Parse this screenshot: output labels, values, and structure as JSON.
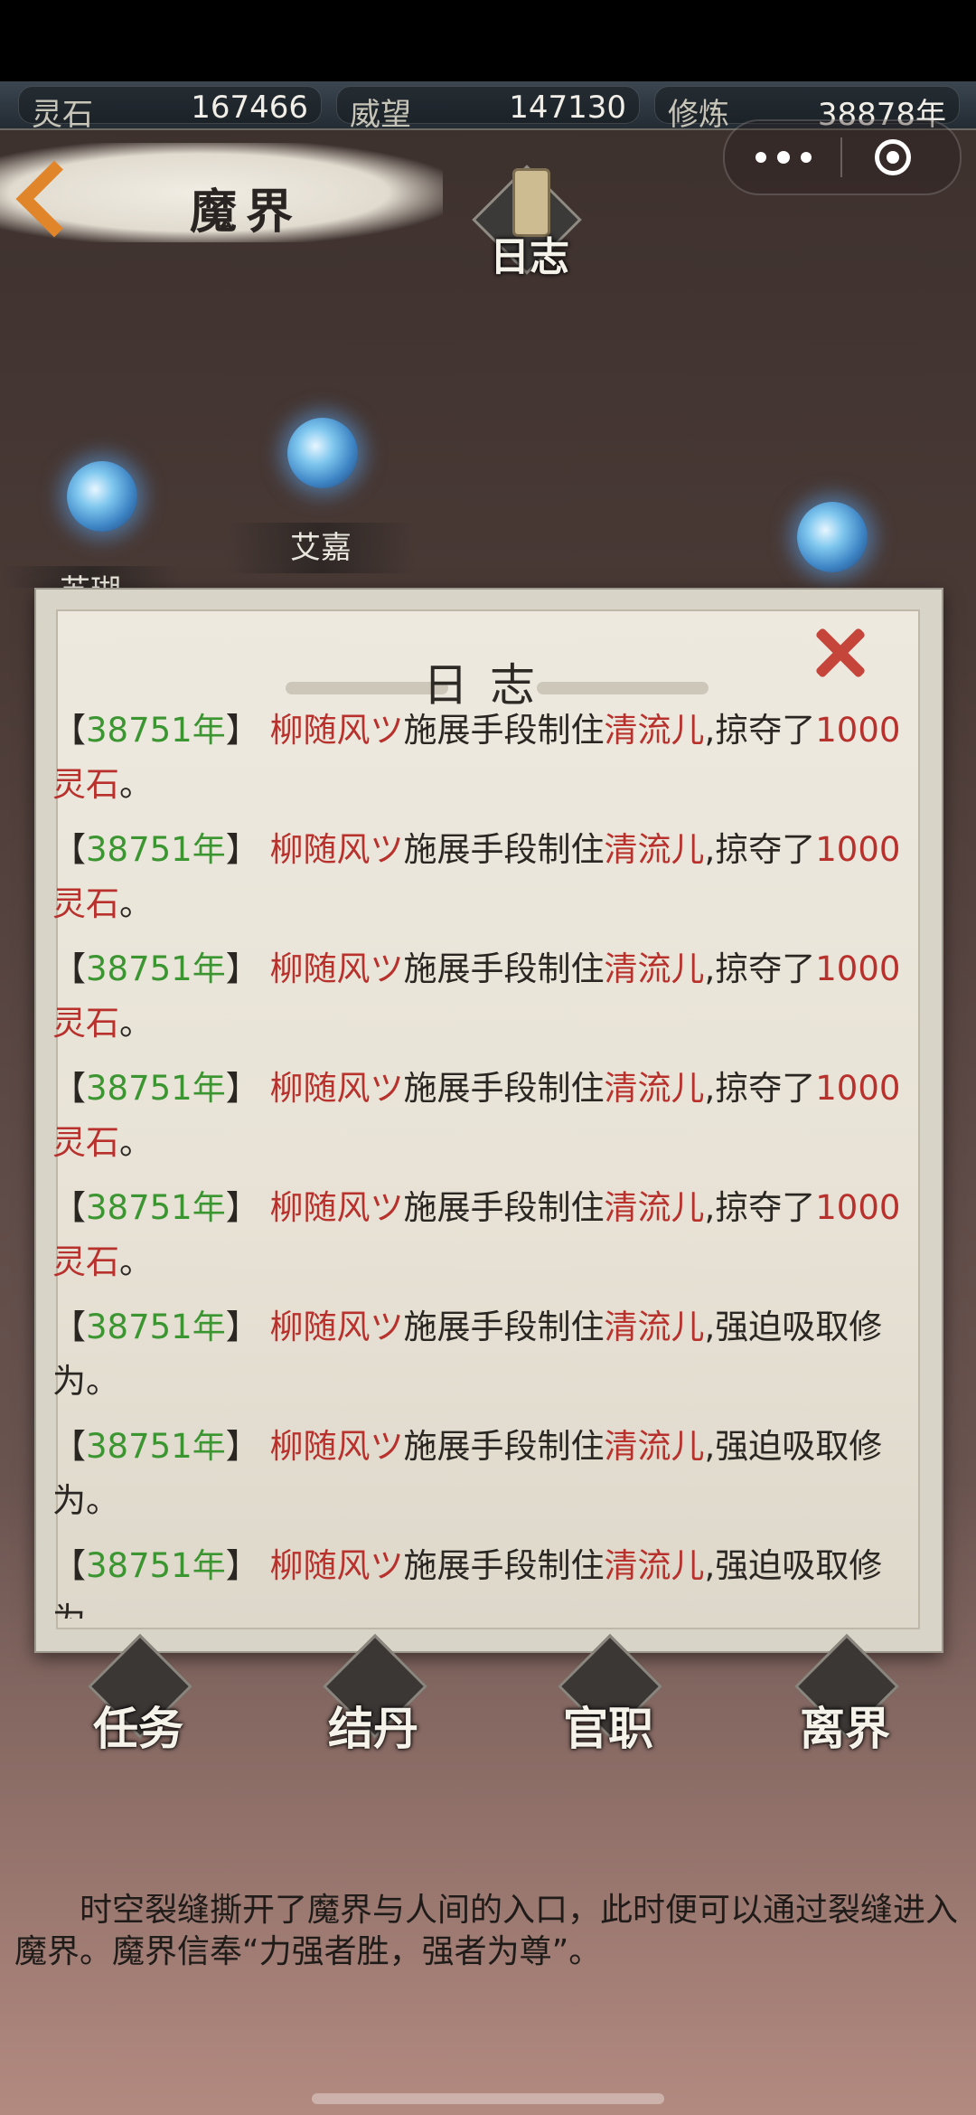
{
  "stats": [
    {
      "label": "灵石",
      "value": "167466"
    },
    {
      "label": "威望",
      "value": "147130"
    },
    {
      "label": "修炼",
      "value": "38878年"
    }
  ],
  "header": {
    "title": "魔界"
  },
  "log_button": {
    "label": "日志"
  },
  "map": {
    "names": [
      "艾嘉",
      "苏瑚"
    ]
  },
  "dialog": {
    "title": "日志",
    "entries": [
      {
        "year": "38751年",
        "actor": "柳随风ツ",
        "verb": "施展手段制住",
        "target": "清流儿",
        "tail": ",掠夺了",
        "amount": "1000灵石",
        "end": "。"
      },
      {
        "year": "38751年",
        "actor": "柳随风ツ",
        "verb": "施展手段制住",
        "target": "清流儿",
        "tail": ",掠夺了",
        "amount": "1000灵石",
        "end": "。"
      },
      {
        "year": "38751年",
        "actor": "柳随风ツ",
        "verb": "施展手段制住",
        "target": "清流儿",
        "tail": ",掠夺了",
        "amount": "1000灵石",
        "end": "。"
      },
      {
        "year": "38751年",
        "actor": "柳随风ツ",
        "verb": "施展手段制住",
        "target": "清流儿",
        "tail": ",掠夺了",
        "amount": "1000灵石",
        "end": "。"
      },
      {
        "year": "38751年",
        "actor": "柳随风ツ",
        "verb": "施展手段制住",
        "target": "清流儿",
        "tail": ",掠夺了",
        "amount": "1000灵石",
        "end": "。"
      },
      {
        "year": "38751年",
        "actor": "柳随风ツ",
        "verb": "施展手段制住",
        "target": "清流儿",
        "tail": ",强迫吸取修为。",
        "amount": "",
        "end": ""
      },
      {
        "year": "38751年",
        "actor": "柳随风ツ",
        "verb": "施展手段制住",
        "target": "清流儿",
        "tail": ",强迫吸取修为。",
        "amount": "",
        "end": ""
      },
      {
        "year": "38751年",
        "actor": "柳随风ツ",
        "verb": "施展手段制住",
        "target": "清流儿",
        "tail": ",强迫吸取修为。",
        "amount": "",
        "end": ""
      }
    ]
  },
  "bottom_buttons": [
    {
      "label": "任务"
    },
    {
      "label": "结丹"
    },
    {
      "label": "官职"
    },
    {
      "label": "离界"
    }
  ],
  "description": "时空裂缝撕开了魔界与人间的入口，此时便可以通过裂缝进入魔界。魔界信奉“力强者胜，强者为尊”。"
}
